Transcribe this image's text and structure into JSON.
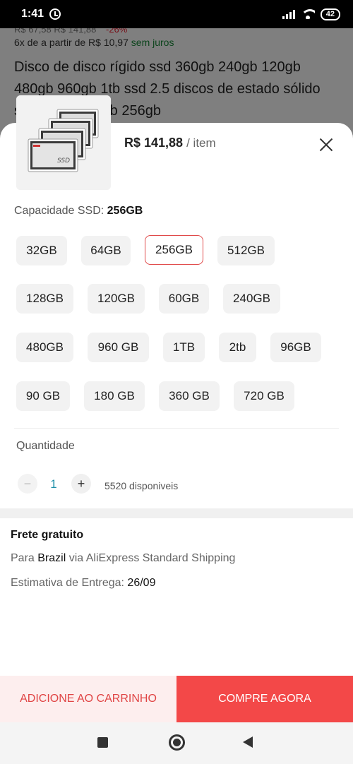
{
  "status_bar": {
    "time": "1:41",
    "battery": "42",
    "icons": [
      "alarm-icon",
      "signal-icon",
      "wifi-icon",
      "battery-icon"
    ]
  },
  "background_page": {
    "price_row": "R$ 67,58  R$ 141,88",
    "discount": "-26%",
    "installments_prefix": "6x de a partir de R$ 10,97",
    "installments_suffix": "sem juros",
    "title": "Disco de disco rígido ssd 360gb 240gb 120gb 480gb 960gb 1tb ssd 2.5 discos de estado sólido sata 3 ssd128gb 256gb"
  },
  "sheet": {
    "price": "R$ 141,88",
    "unit": "/ item",
    "capacity_label": "Capacidade SSD:",
    "capacity_value": "256GB",
    "options": [
      "32GB",
      "64GB",
      "256GB",
      "512GB",
      "128GB",
      "120GB",
      "60GB",
      "240GB",
      "480GB",
      "960 GB",
      "1TB",
      "2tb",
      "96GB",
      "90 GB",
      "180 GB",
      "360 GB",
      "720 GB"
    ],
    "selected_option": "256GB",
    "quantity_label": "Quantidade",
    "quantity_minus": "−",
    "quantity_value": "1",
    "quantity_plus": "+",
    "available": "5520 disponiveis",
    "shipping_title": "Frete gratuito",
    "shipping_prefix": "Para",
    "shipping_destination": "Brazil",
    "shipping_suffix": "via AliExpress Standard Shipping",
    "eta_label": "Estimativa de Entrega:",
    "eta_date": "26/09",
    "add_to_cart": "ADICIONE AO CARRINHO",
    "buy_now": "COMPRE AGORA"
  },
  "colors": {
    "accent": "#f34848",
    "cart_bg": "#fdeeee",
    "selected_border": "#e04a4a",
    "quantity_value": "#1e8fa8",
    "free_text": "#1a8a3a"
  },
  "navigation": {
    "icons": [
      "recents-square-icon",
      "home-circle-icon",
      "back-triangle-icon"
    ]
  }
}
